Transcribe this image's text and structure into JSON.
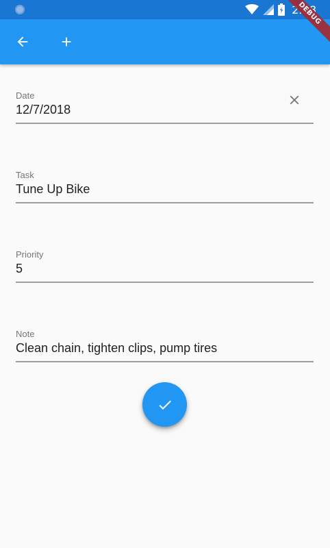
{
  "status_bar": {
    "time": "2:08",
    "icons": [
      "wifi-icon",
      "cell-signal-icon",
      "battery-icon"
    ]
  },
  "debug_banner": {
    "label": "DEBUG"
  },
  "app_bar": {
    "back_icon": "arrow-back-icon",
    "add_icon": "add-icon"
  },
  "form": {
    "fields": [
      {
        "label": "Date",
        "value": "12/7/2018",
        "clearable": true
      },
      {
        "label": "Task",
        "value": "Tune Up Bike"
      },
      {
        "label": "Priority",
        "value": "5"
      },
      {
        "label": "Note",
        "value": "Clean chain, tighten clips, pump tires"
      }
    ]
  },
  "fab": {
    "icon": "check-icon"
  },
  "colors": {
    "primary": "#2196f3",
    "primary_dark": "#1976d2",
    "background": "#fafafa",
    "debug": "#a5282e"
  }
}
